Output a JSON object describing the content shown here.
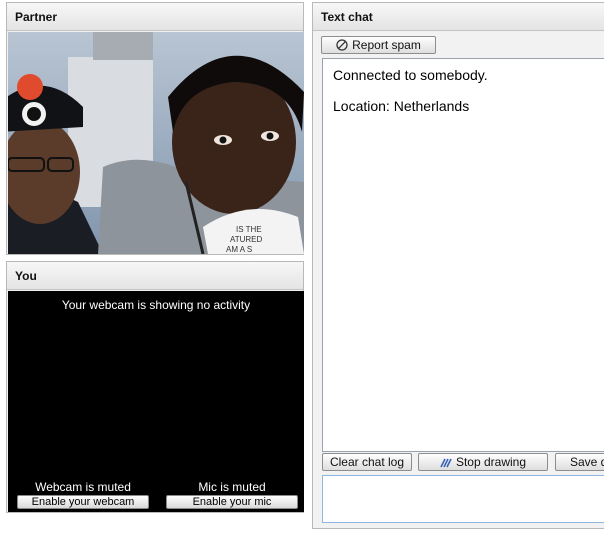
{
  "partner": {
    "title": "Partner",
    "shirt_text": [
      "IS THE",
      "ATURED",
      "AM A S"
    ]
  },
  "you": {
    "title": "You",
    "webcam_status": "Your webcam is showing no activity",
    "webcam_muted": "Webcam is muted",
    "enable_webcam": "Enable your webcam",
    "mic_muted": "Mic is muted",
    "enable_mic": "Enable your mic"
  },
  "chat": {
    "title": "Text chat",
    "report_spam": "Report spam",
    "messages": [
      "Connected to somebody.",
      "Location: Netherlands"
    ],
    "clear_log": "Clear chat log",
    "stop_drawing": "Stop drawing",
    "save": "Save d",
    "input_value": ""
  },
  "icons": {
    "report": "no-entry-icon",
    "draw": "pen-icon"
  },
  "colors": {
    "cam_bg": "#000000",
    "input_border": "#8fb6de"
  }
}
